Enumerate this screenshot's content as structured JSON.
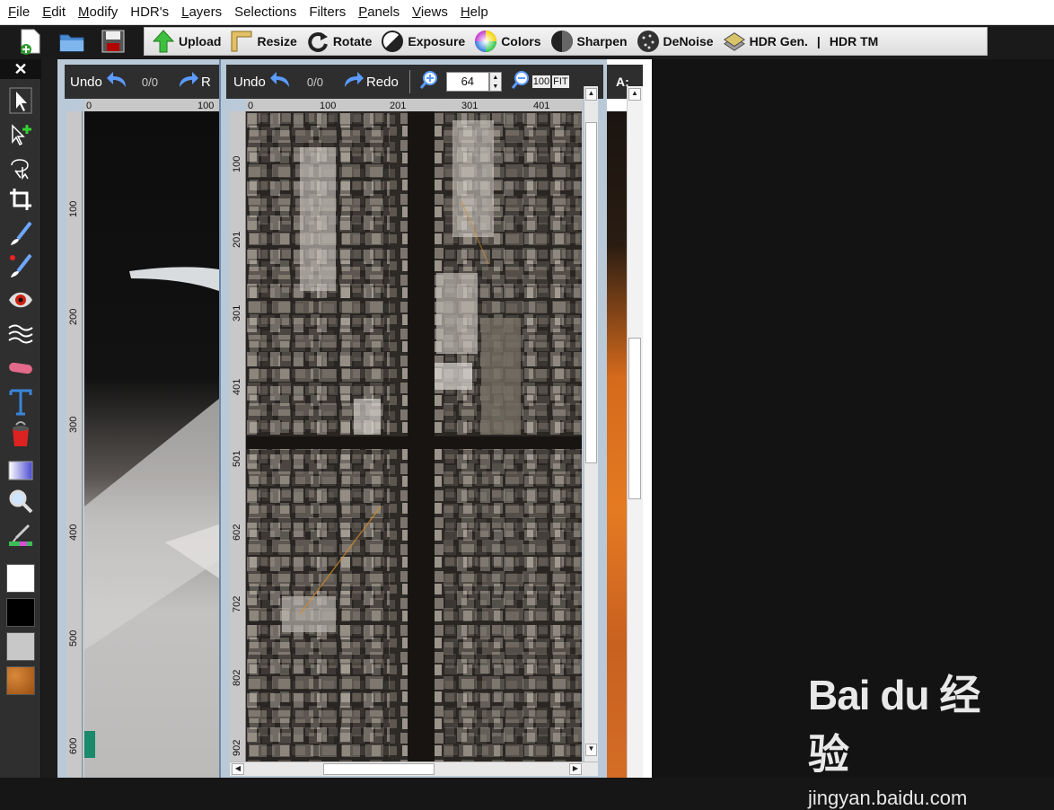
{
  "menu": {
    "items": [
      {
        "u": "F",
        "rest": "ile"
      },
      {
        "u": "E",
        "rest": "dit"
      },
      {
        "u": "M",
        "rest": "odify"
      },
      {
        "u": "",
        "rest": "HDR's"
      },
      {
        "u": "L",
        "rest": "ayers"
      },
      {
        "u": "",
        "rest": "Selections"
      },
      {
        "u": "",
        "rest": "Filters"
      },
      {
        "u": "P",
        "rest": "anels"
      },
      {
        "u": "V",
        "rest": "iews"
      },
      {
        "u": "H",
        "rest": "elp"
      }
    ]
  },
  "toolbar": {
    "upload": "Upload",
    "resize": "Resize",
    "rotate": "Rotate",
    "exposure": "Exposure",
    "colors": "Colors",
    "sharpen": "Sharpen",
    "denoise": "DeNoise",
    "hdr_gen": "HDR Gen.",
    "separator": "|",
    "hdr_tm": "HDR TM"
  },
  "leftbar": {
    "close": "✕",
    "colors": {
      "fg": "#ffffff",
      "bg": "#000000",
      "third": "#c8c8c8",
      "pattern": "#b86a1e"
    }
  },
  "window1": {
    "undo": "Undo",
    "counter": "0/0",
    "redo_partial": "R",
    "hruler": [
      "0",
      "100"
    ],
    "vruler": [
      "100",
      "200",
      "300",
      "400",
      "500",
      "600"
    ]
  },
  "window2": {
    "undo": "Undo",
    "counter": "0/0",
    "redo": "Redo",
    "zoom": "64",
    "zoom100": "100",
    "fit": "FIT",
    "hruler": [
      "0",
      "100",
      "201",
      "301",
      "401"
    ],
    "vruler": [
      "100",
      "201",
      "301",
      "401",
      "501",
      "602",
      "702",
      "802",
      "902"
    ]
  },
  "window3": {
    "label": "A:"
  },
  "watermark": {
    "logo": "Bai du 经验",
    "url": "jingyan.baidu.com"
  }
}
